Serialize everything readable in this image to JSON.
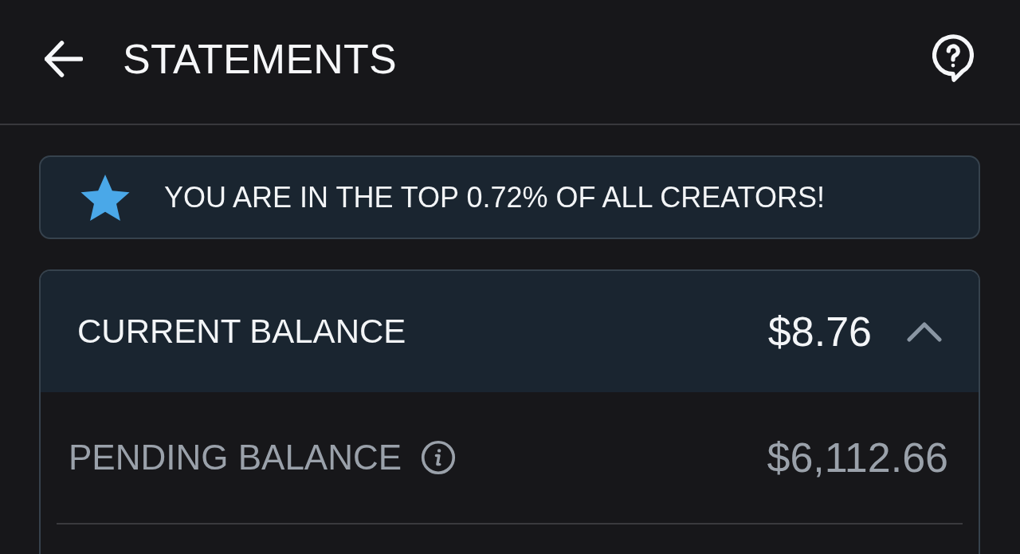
{
  "header": {
    "title": "STATEMENTS"
  },
  "banner": {
    "text": "YOU ARE IN THE TOP 0.72% OF ALL CREATORS!"
  },
  "balance_card": {
    "label": "CURRENT BALANCE",
    "amount": "$8.76",
    "expanded": true,
    "rows": [
      {
        "label": "PENDING BALANCE",
        "amount": "$6,112.66"
      }
    ]
  }
}
